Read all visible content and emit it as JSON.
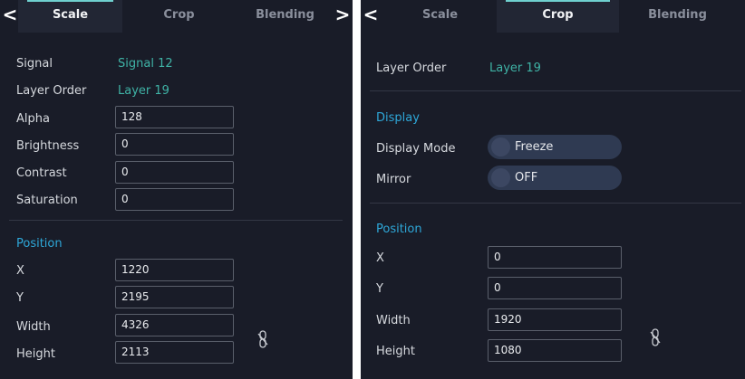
{
  "left_panel": {
    "tabs": [
      "Scale",
      "Crop",
      "Blending"
    ],
    "nav_prev": "<",
    "nav_next": ">",
    "signal_label": "Signal",
    "signal_value": "Signal  12",
    "layer_order_label": "Layer Order",
    "layer_order_value": "Layer 19",
    "alpha_label": "Alpha",
    "alpha_value": "128",
    "brightness_label": "Brightness",
    "brightness_value": "0",
    "contrast_label": "Contrast",
    "contrast_value": "0",
    "saturation_label": "Saturation",
    "saturation_value": "0",
    "position_heading": "Position",
    "x_label": "X",
    "x_value": "1220",
    "y_label": "Y",
    "y_value": "2195",
    "width_label": "Width",
    "width_value": "4326",
    "height_label": "Height",
    "height_value": "2113"
  },
  "right_panel": {
    "tabs": [
      "Scale",
      "Crop",
      "Blending"
    ],
    "nav_prev": "<",
    "layer_order_label": "Layer Order",
    "layer_order_value": "Layer 19",
    "display_heading": "Display",
    "display_mode_label": "Display Mode",
    "display_mode_value": "Freeze",
    "mirror_label": "Mirror",
    "mirror_value": "OFF",
    "position_heading": "Position",
    "x_label": "X",
    "x_value": "0",
    "y_label": "Y",
    "y_value": "0",
    "width_label": "Width",
    "width_value": "1920",
    "height_label": "Height",
    "height_value": "1080"
  },
  "colors": {
    "panel_bg": "#191c28",
    "value_teal": "#3fb3a6",
    "section_blue": "#2ea7d8",
    "tab_indicator": "#6fd0cf",
    "toggle_bg": "#2f3a52"
  },
  "icons": [
    "chevron-left-icon",
    "chevron-right-icon",
    "link-icon"
  ]
}
